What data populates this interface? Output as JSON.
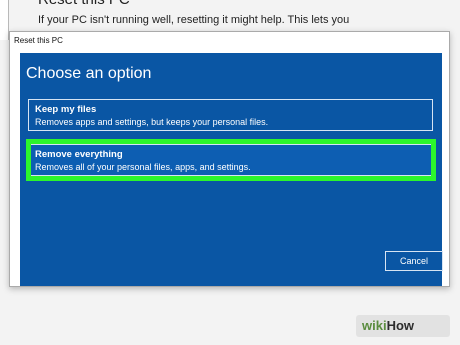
{
  "background": {
    "title": "Reset this PC",
    "text": "If your PC isn't running well, resetting it might help. This lets you"
  },
  "dialog": {
    "title": "Reset this PC",
    "heading": "Choose an option",
    "options": [
      {
        "title": "Keep my files",
        "description": "Removes apps and settings, but keeps your personal files."
      },
      {
        "title": "Remove everything",
        "description": "Removes all of your personal files, apps, and settings."
      }
    ],
    "cancel_label": "Cancel",
    "highlighted_option": "Remove everything"
  },
  "watermark": {
    "part1": "wiki",
    "part2": "How"
  },
  "colors": {
    "dialog_blue": "#0a56a4",
    "highlight_green": "#2cf52b"
  }
}
